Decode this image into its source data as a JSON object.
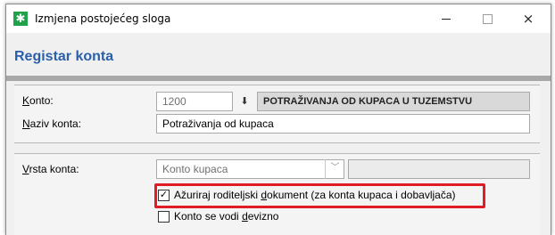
{
  "window": {
    "title": "Izmjena postojećeg sloga",
    "app_icon": "green-star-icon",
    "controls": {
      "minimize": "minimize-icon",
      "maximize": "maximize-icon",
      "close": "×"
    }
  },
  "header": {
    "title": "Registar konta"
  },
  "form": {
    "konto": {
      "label_u": "K",
      "label_rest": "onto:",
      "code": "1200",
      "lookup_icon": "⬇",
      "description": "POTRAŽIVANJA OD KUPACA U TUZEMSTVU"
    },
    "naziv": {
      "label_u": "N",
      "label_rest": "aziv konta:",
      "value": "Potraživanja od kupaca"
    },
    "vrsta": {
      "label_u": "V",
      "label_rest": "rsta konta:",
      "selected": "Konto kupaca",
      "dropdown_icon": "﹀",
      "extra_value": ""
    },
    "azuriraj": {
      "checked": true,
      "check_glyph": "✓",
      "label_before": "Ažuriraj roditeljski ",
      "label_u": "d",
      "label_after": "okument (za konta kupaca i dobavljača)"
    },
    "devizno": {
      "checked": false,
      "label_before": "Konto se vodi ",
      "label_u": "d",
      "label_after": "evizno"
    }
  },
  "colors": {
    "accent_title": "#2a5faa",
    "highlight_border": "#e01c24",
    "app_icon_bg": "#1fa24a"
  }
}
